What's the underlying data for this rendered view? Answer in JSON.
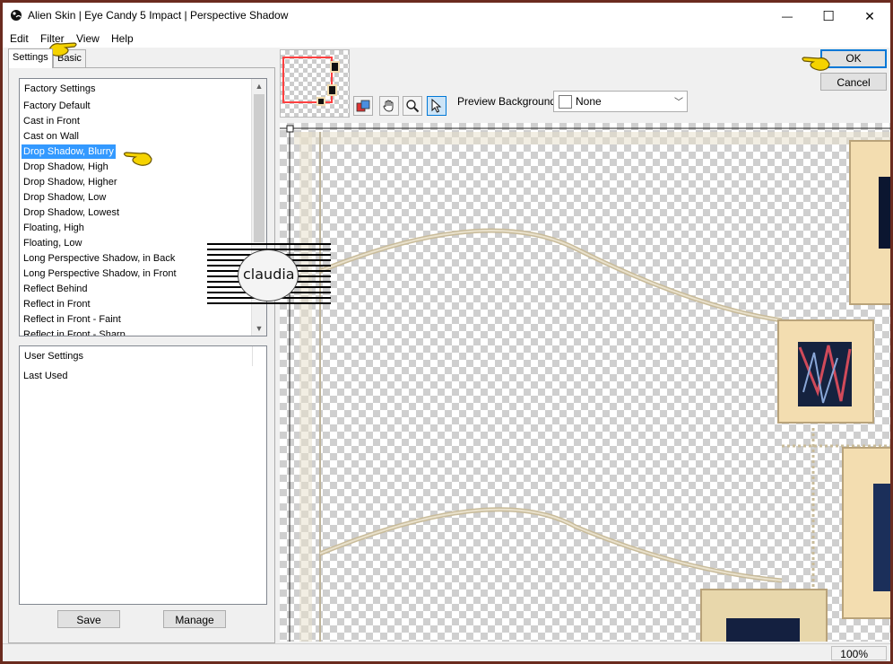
{
  "window": {
    "title": "Alien Skin | Eye Candy 5 Impact | Perspective Shadow",
    "minimize": "—",
    "maximize": "☐",
    "close": "✕"
  },
  "menu": [
    "Edit",
    "Filter",
    "View",
    "Help"
  ],
  "tabs": {
    "settings": "Settings",
    "basic": "Basic"
  },
  "factory": {
    "heading": "Factory Settings",
    "items": [
      "Factory Default",
      "Cast in Front",
      "Cast on Wall",
      "Drop Shadow, Blurry",
      "Drop Shadow, High",
      "Drop Shadow, Higher",
      "Drop Shadow, Low",
      "Drop Shadow, Lowest",
      "Floating, High",
      "Floating, Low",
      "Long Perspective Shadow, in Back",
      "Long Perspective Shadow, in Front",
      "Reflect Behind",
      "Reflect in Front",
      "Reflect in Front - Faint",
      "Reflect in Front - Sharp"
    ],
    "selected_index": 3
  },
  "user": {
    "heading": "User Settings",
    "items": [
      "Last Used"
    ]
  },
  "buttons": {
    "save": "Save",
    "manage": "Manage",
    "ok": "OK",
    "cancel": "Cancel"
  },
  "preview_background": {
    "label": "Preview Background:",
    "value": "None"
  },
  "status": {
    "zoom": "100%"
  },
  "watermark": {
    "text": "claudia"
  },
  "colors": {
    "selection": "#3399ff",
    "frame": "#6b2b1f",
    "pointer": "#f5d300",
    "cream": "#f3ddb0"
  }
}
